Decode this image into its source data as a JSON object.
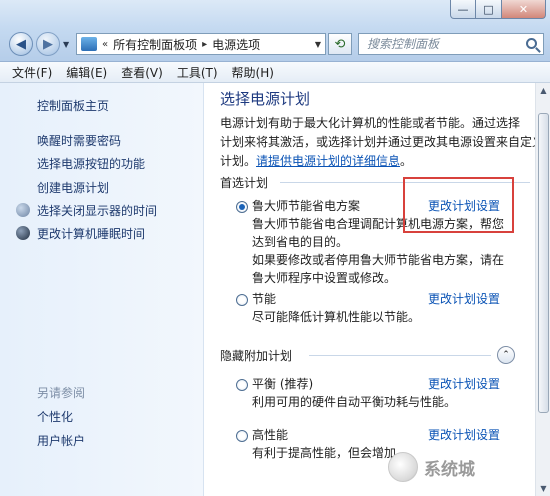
{
  "window": {
    "caption": {
      "minimize": "—",
      "maximize": "□",
      "close": "✕"
    }
  },
  "address_bar": {
    "separator": "«",
    "crumbs": [
      "所有控制面板项",
      "电源选项"
    ],
    "crumb_sep": "▸",
    "refresh_glyph": "⟲",
    "search_placeholder": "搜索控制面板"
  },
  "menubar": {
    "items": [
      "文件(F)",
      "编辑(E)",
      "查看(V)",
      "工具(T)",
      "帮助(H)"
    ]
  },
  "sidebar": {
    "home": "控制面板主页",
    "links": [
      "唤醒时需要密码",
      "选择电源按钮的功能",
      "创建电源计划",
      "选择关闭显示器的时间",
      "更改计算机睡眠时间"
    ],
    "see_also_title": "另请参阅",
    "see_also": [
      "个性化",
      "用户帐户"
    ]
  },
  "main": {
    "title": "选择电源计划",
    "intro_lines": [
      "电源计划有助于最大化计算机的性能或者节能。通过选择",
      "计划来将其激活，或选择计划并通过更改其电源设置来自定义",
      "计划。"
    ],
    "intro_link": "请提供电源计划的详细信息",
    "intro_link_suffix": "。",
    "preferred_title": "首选计划",
    "plans": [
      {
        "name": "鲁大师节能省电方案",
        "selected": true,
        "desc_lines": [
          "鲁大师节能省电合理调配计算机电源方案，帮您",
          "达到省电的目的。",
          "如果要修改或者停用鲁大师节能省电方案，请在",
          "鲁大师程序中设置或修改。"
        ],
        "change_label": "更改计划设置"
      },
      {
        "name": "节能",
        "selected": false,
        "desc_lines": [
          "尽可能降低计算机性能以节能。"
        ],
        "change_label": "更改计划设置"
      }
    ],
    "hidden_title": "隐藏附加计划",
    "collapse_glyph": "⌃",
    "hidden_plans": [
      {
        "name": "平衡 (推荐)",
        "selected": false,
        "desc_lines": [
          "利用可用的硬件自动平衡功耗与性能。"
        ],
        "change_label": "更改计划设置"
      },
      {
        "name": "高性能",
        "selected": false,
        "desc_lines": [
          "有利于提高性能，但会增加"
        ],
        "change_label": "更改计划设置"
      }
    ]
  },
  "scrollbar": {
    "up": "▲",
    "down": "▼"
  },
  "watermark": {
    "text": "系统城"
  }
}
